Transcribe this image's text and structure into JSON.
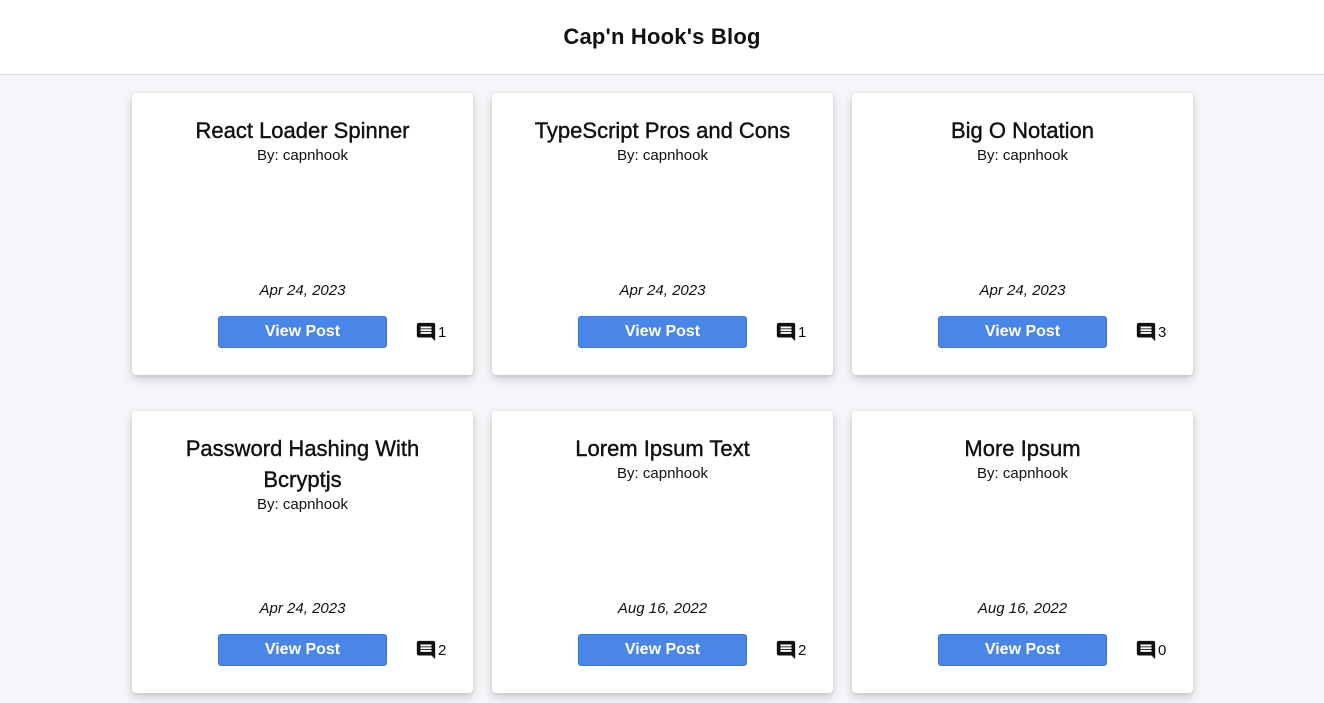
{
  "header": {
    "title": "Cap'n Hook's Blog"
  },
  "posts": [
    {
      "title": "React Loader Spinner",
      "author": "By: capnhook",
      "date": "Apr 24, 2023",
      "button": "View Post",
      "comments": "1"
    },
    {
      "title": "TypeScript Pros and Cons",
      "author": "By: capnhook",
      "date": "Apr 24, 2023",
      "button": "View Post",
      "comments": "1"
    },
    {
      "title": "Big O Notation",
      "author": "By: capnhook",
      "date": "Apr 24, 2023",
      "button": "View Post",
      "comments": "3"
    },
    {
      "title": "Password Hashing With Bcryptjs",
      "author": "By: capnhook",
      "date": "Apr 24, 2023",
      "button": "View Post",
      "comments": "2"
    },
    {
      "title": "Lorem Ipsum Text",
      "author": "By: capnhook",
      "date": "Aug 16, 2022",
      "button": "View Post",
      "comments": "2"
    },
    {
      "title": "More Ipsum",
      "author": "By: capnhook",
      "date": "Aug 16, 2022",
      "button": "View Post",
      "comments": "0"
    }
  ],
  "icons": {
    "comment": "comment-icon"
  },
  "colors": {
    "button_bg": "#4a86e8",
    "button_text": "#ffffff",
    "page_bg": "#f4f6f9"
  }
}
